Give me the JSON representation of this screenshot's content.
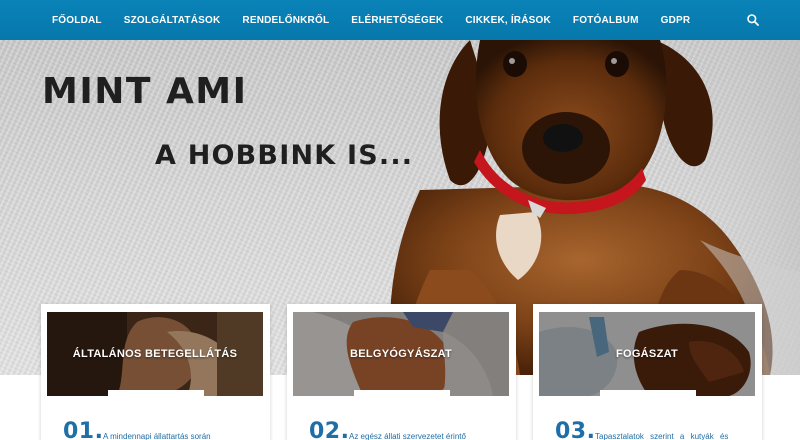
{
  "nav": {
    "items": [
      {
        "label": "FŐOLDAL"
      },
      {
        "label": "SZOLGÁLTATÁSOK"
      },
      {
        "label": "RENDELŐNKRŐL"
      },
      {
        "label": "ELÉRHETŐSÉGEK"
      },
      {
        "label": "CIKKEK, ÍRÁSOK"
      },
      {
        "label": "FOTÓALBUM"
      },
      {
        "label": "GDPR"
      }
    ],
    "search_icon": "search-icon",
    "background_color": "#0677ab"
  },
  "hero": {
    "title_line1": "MINT AMI",
    "title_line2": "A HOBBINK IS..."
  },
  "cards": [
    {
      "title": "ÁLTALÁNOS BETEGELLÁTÁS",
      "number": "01.",
      "text": "A mindennapi állattartás során"
    },
    {
      "title": "BELGYÓGYÁSZAT",
      "number": "02.",
      "text": "Az egész állati szervezetet érintő"
    },
    {
      "title": "FOGÁSZAT",
      "number": "03.",
      "text": "Tapasztalatok szerint a kutyák és"
    }
  ],
  "colors": {
    "accent": "#1e6ea7",
    "nav": "#0677ab"
  }
}
